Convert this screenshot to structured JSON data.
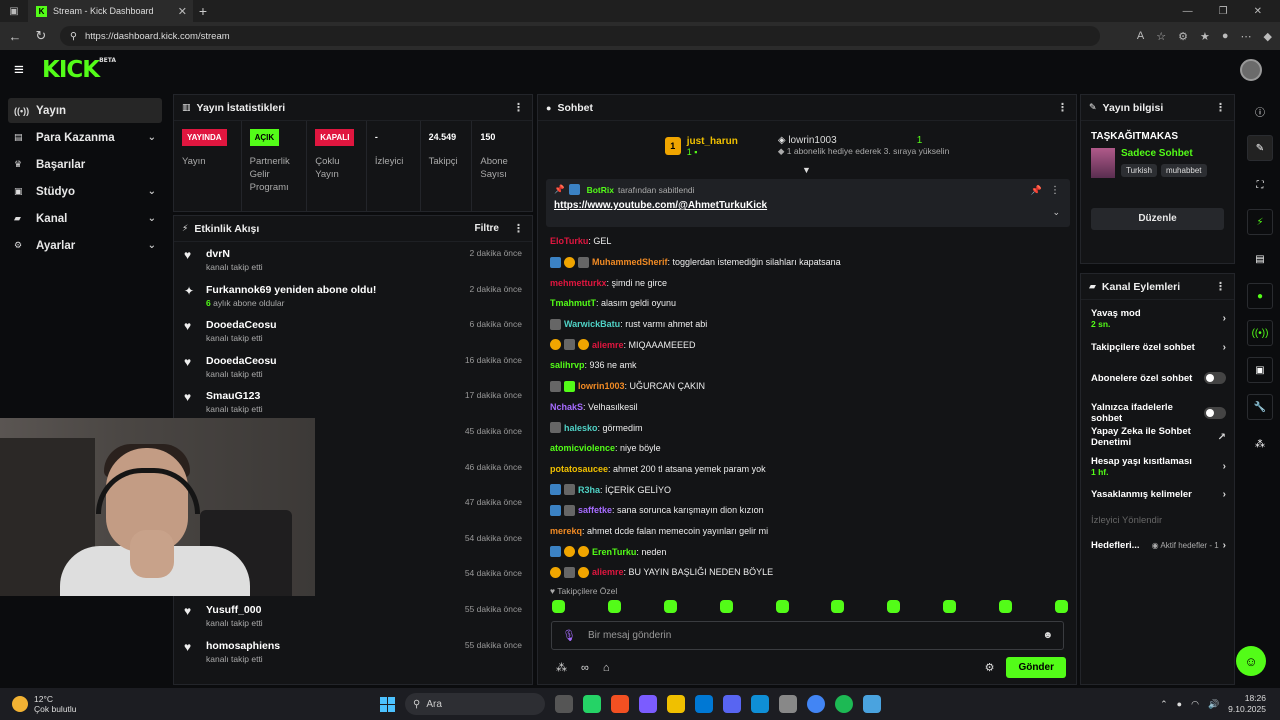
{
  "browser": {
    "tab_title": "Stream - Kick Dashboard",
    "url": "https://dashboard.kick.com/stream"
  },
  "app": {
    "logo": "KICK",
    "logo_tag": "BETA"
  },
  "sidebar": {
    "items": [
      {
        "label": "Yayın",
        "icon": "broadcast-icon"
      },
      {
        "label": "Para Kazanma",
        "icon": "money-icon"
      },
      {
        "label": "Başarılar",
        "icon": "trophy-icon"
      },
      {
        "label": "Stüdyo",
        "icon": "studio-icon"
      },
      {
        "label": "Kanal",
        "icon": "channel-icon"
      },
      {
        "label": "Ayarlar",
        "icon": "gear-icon"
      }
    ]
  },
  "stats": {
    "title": "Yayın İstatistikleri",
    "items": [
      {
        "value": "YAYINDA",
        "label": "Yayın"
      },
      {
        "value": "AÇIK",
        "label": "Partnerlik Gelir Programı"
      },
      {
        "value": "KAPALI",
        "label": "Çoklu Yayın"
      },
      {
        "value": "-",
        "label": "İzleyici"
      },
      {
        "value": "24.549",
        "label": "Takipçi"
      },
      {
        "value": "150",
        "label": "Abone Sayısı"
      }
    ]
  },
  "activity": {
    "title": "Etkinlik Akışı",
    "filter": "Filtre",
    "items": [
      {
        "name": "dvrN",
        "sub": "kanalı takip etti",
        "time": "2 dakika önce"
      },
      {
        "name": "Furkannok69 yeniden abone oldu!",
        "sub_count": "6",
        "sub": "aylık abone oldular",
        "time": "2 dakika önce"
      },
      {
        "name": "DooedaCeosu",
        "sub": "kanalı takip etti",
        "time": "6 dakika önce"
      },
      {
        "name": "DooedaCeosu",
        "sub": "kanalı takip etti",
        "time": "16 dakika önce"
      },
      {
        "name": "SmauG123",
        "sub": "kanalı takip etti",
        "time": "17 dakika önce"
      },
      {
        "name": "",
        "sub": "",
        "time": "45 dakika önce"
      },
      {
        "name": "",
        "sub": "",
        "time": "46 dakika önce"
      },
      {
        "name": "",
        "sub": "",
        "time": "47 dakika önce"
      },
      {
        "name": "",
        "sub": "",
        "time": "54 dakika önce"
      },
      {
        "name": "",
        "sub": "",
        "time": "54 dakika önce"
      },
      {
        "name": "Yusuff_000",
        "sub": "kanalı takip etti",
        "time": "55 dakika önce"
      },
      {
        "name": "homosaphiens",
        "sub": "kanalı takip etti",
        "time": "55 dakika önce"
      }
    ]
  },
  "chat": {
    "title": "Sohbet",
    "leader": {
      "rank": "1",
      "name": "just_harun",
      "count": "1"
    },
    "gifter": {
      "name": "lowrin1003",
      "count": "1",
      "status": "1 abonelik hediye ederek 3. sıraya yükselin"
    },
    "pinned": {
      "by": "BotRix",
      "by_text": "tarafından sabitlendi",
      "link": "https://www.youtube.com/@AhmetTurkuKick"
    },
    "messages": [
      {
        "user": "EloTurku",
        "color": "#e0163f",
        "text": "GEL",
        "badges": []
      },
      {
        "user": "MuhammedSherif",
        "color": "#f08a24",
        "text": "togglerdan istemediğin silahları kapatsana",
        "badges": [
          "blue",
          "gold",
          "grey"
        ]
      },
      {
        "user": "mehmetturkx",
        "color": "#e0163f",
        "text": "şimdi ne girce",
        "badges": []
      },
      {
        "user": "TmahmutT",
        "color": "#53fc18",
        "text": "alasım geldi oyunu",
        "badges": []
      },
      {
        "user": "WarwickBatu",
        "color": "#4fd1c5",
        "text": "rust varmı ahmet abi",
        "badges": [
          "grey"
        ]
      },
      {
        "user": "aliemre",
        "color": "#e0163f",
        "text": "MIQAAAMEEED",
        "badges": [
          "gold",
          "grey",
          "gold"
        ]
      },
      {
        "user": "salihrvp",
        "color": "#53fc18",
        "text": "936 ne amk",
        "badges": []
      },
      {
        "user": "lowrin1003",
        "color": "#f08a24",
        "text": "UĞURCAN ÇAKIN",
        "badges": [
          "grey",
          "grn"
        ]
      },
      {
        "user": "NchakS",
        "color": "#a66cff",
        "text": "Velhasılkesil",
        "badges": []
      },
      {
        "user": "halesko",
        "color": "#4fd1c5",
        "text": "görmedim",
        "badges": [
          "grey"
        ]
      },
      {
        "user": "atomicviolence",
        "color": "#53fc18",
        "text": "niye böyle",
        "badges": []
      },
      {
        "user": "potatosaucee",
        "color": "#f0c000",
        "text": "ahmet 200 tl atsana yemek param yok",
        "badges": []
      },
      {
        "user": "R3ha",
        "color": "#4fd1c5",
        "text": "İÇERİK GELİYO",
        "badges": [
          "blue",
          "grey"
        ]
      },
      {
        "user": "saffetke",
        "color": "#a66cff",
        "text": "sana sorunca karışmayın dion kızıon",
        "badges": [
          "blue",
          "grey"
        ]
      },
      {
        "user": "merekq",
        "color": "#f08a24",
        "text": "ahmet dcde falan memecoin yayınları gelir mi",
        "badges": []
      },
      {
        "user": "ErenTurku",
        "color": "#53fc18",
        "text": "neden",
        "badges": [
          "blue",
          "gold",
          "gold"
        ]
      },
      {
        "user": "aliemre",
        "color": "#e0163f",
        "text": "BU YAYIN BAŞLIĞI NEDEN BÖYLE",
        "badges": [
          "gold",
          "grey",
          "gold"
        ]
      }
    ],
    "followers_only": "Takipçilere Özel",
    "input_placeholder": "Bir mesaj gönderin",
    "send_label": "Gönder"
  },
  "stream_info": {
    "title": "Yayın bilgisi",
    "stream_title": "TAŞKAĞITMAKAS",
    "category": "Sadece Sohbet",
    "tags": [
      "Turkish",
      "muhabbet"
    ],
    "edit_label": "Düzenle"
  },
  "channel_actions": {
    "title": "Kanal Eylemleri",
    "slow_mode": "Yavaş mod",
    "slow_mode_value": "2 sn.",
    "followers_chat": "Takipçilere özel sohbet",
    "subscribers_chat": "Abonelere özel sohbet",
    "emotes_only": "Yalnızca ifadelerle sohbet",
    "ai_moderation": "Yapay Zeka ile Sohbet Denetimi",
    "account_age": "Hesap yaşı kısıtlaması",
    "account_age_value": "1 hf.",
    "banned_words": "Yasaklanmış kelimeler",
    "viewer_redirect": "İzleyici Yönlendir",
    "goals": "Hedefleri...",
    "goals_value": "Aktif hedefler - 1"
  },
  "taskbar": {
    "temp": "12°C",
    "weather": "Çok bulutlu",
    "search": "Ara",
    "time": "18:26",
    "date": "9.10.2025"
  }
}
